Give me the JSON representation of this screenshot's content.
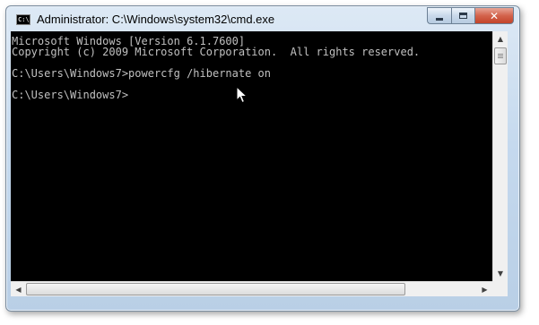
{
  "window": {
    "title": "Administrator: C:\\Windows\\system32\\cmd.exe",
    "icon": "C:\\"
  },
  "caption_buttons": {
    "minimize": "minimize-icon",
    "maximize": "maximize-icon",
    "close_glyph": "✕"
  },
  "console": {
    "lines": [
      "Microsoft Windows [Version 6.1.7600]",
      "Copyright (c) 2009 Microsoft Corporation.  All rights reserved.",
      "",
      "C:\\Users\\Windows7>powercfg /hibernate on",
      "",
      "C:\\Users\\Windows7>"
    ],
    "text_color": "#c0c0c0",
    "background": "#000000"
  },
  "scrollbars": {
    "up_glyph": "▲",
    "down_glyph": "▼",
    "left_glyph": "◀",
    "right_glyph": "▶"
  }
}
